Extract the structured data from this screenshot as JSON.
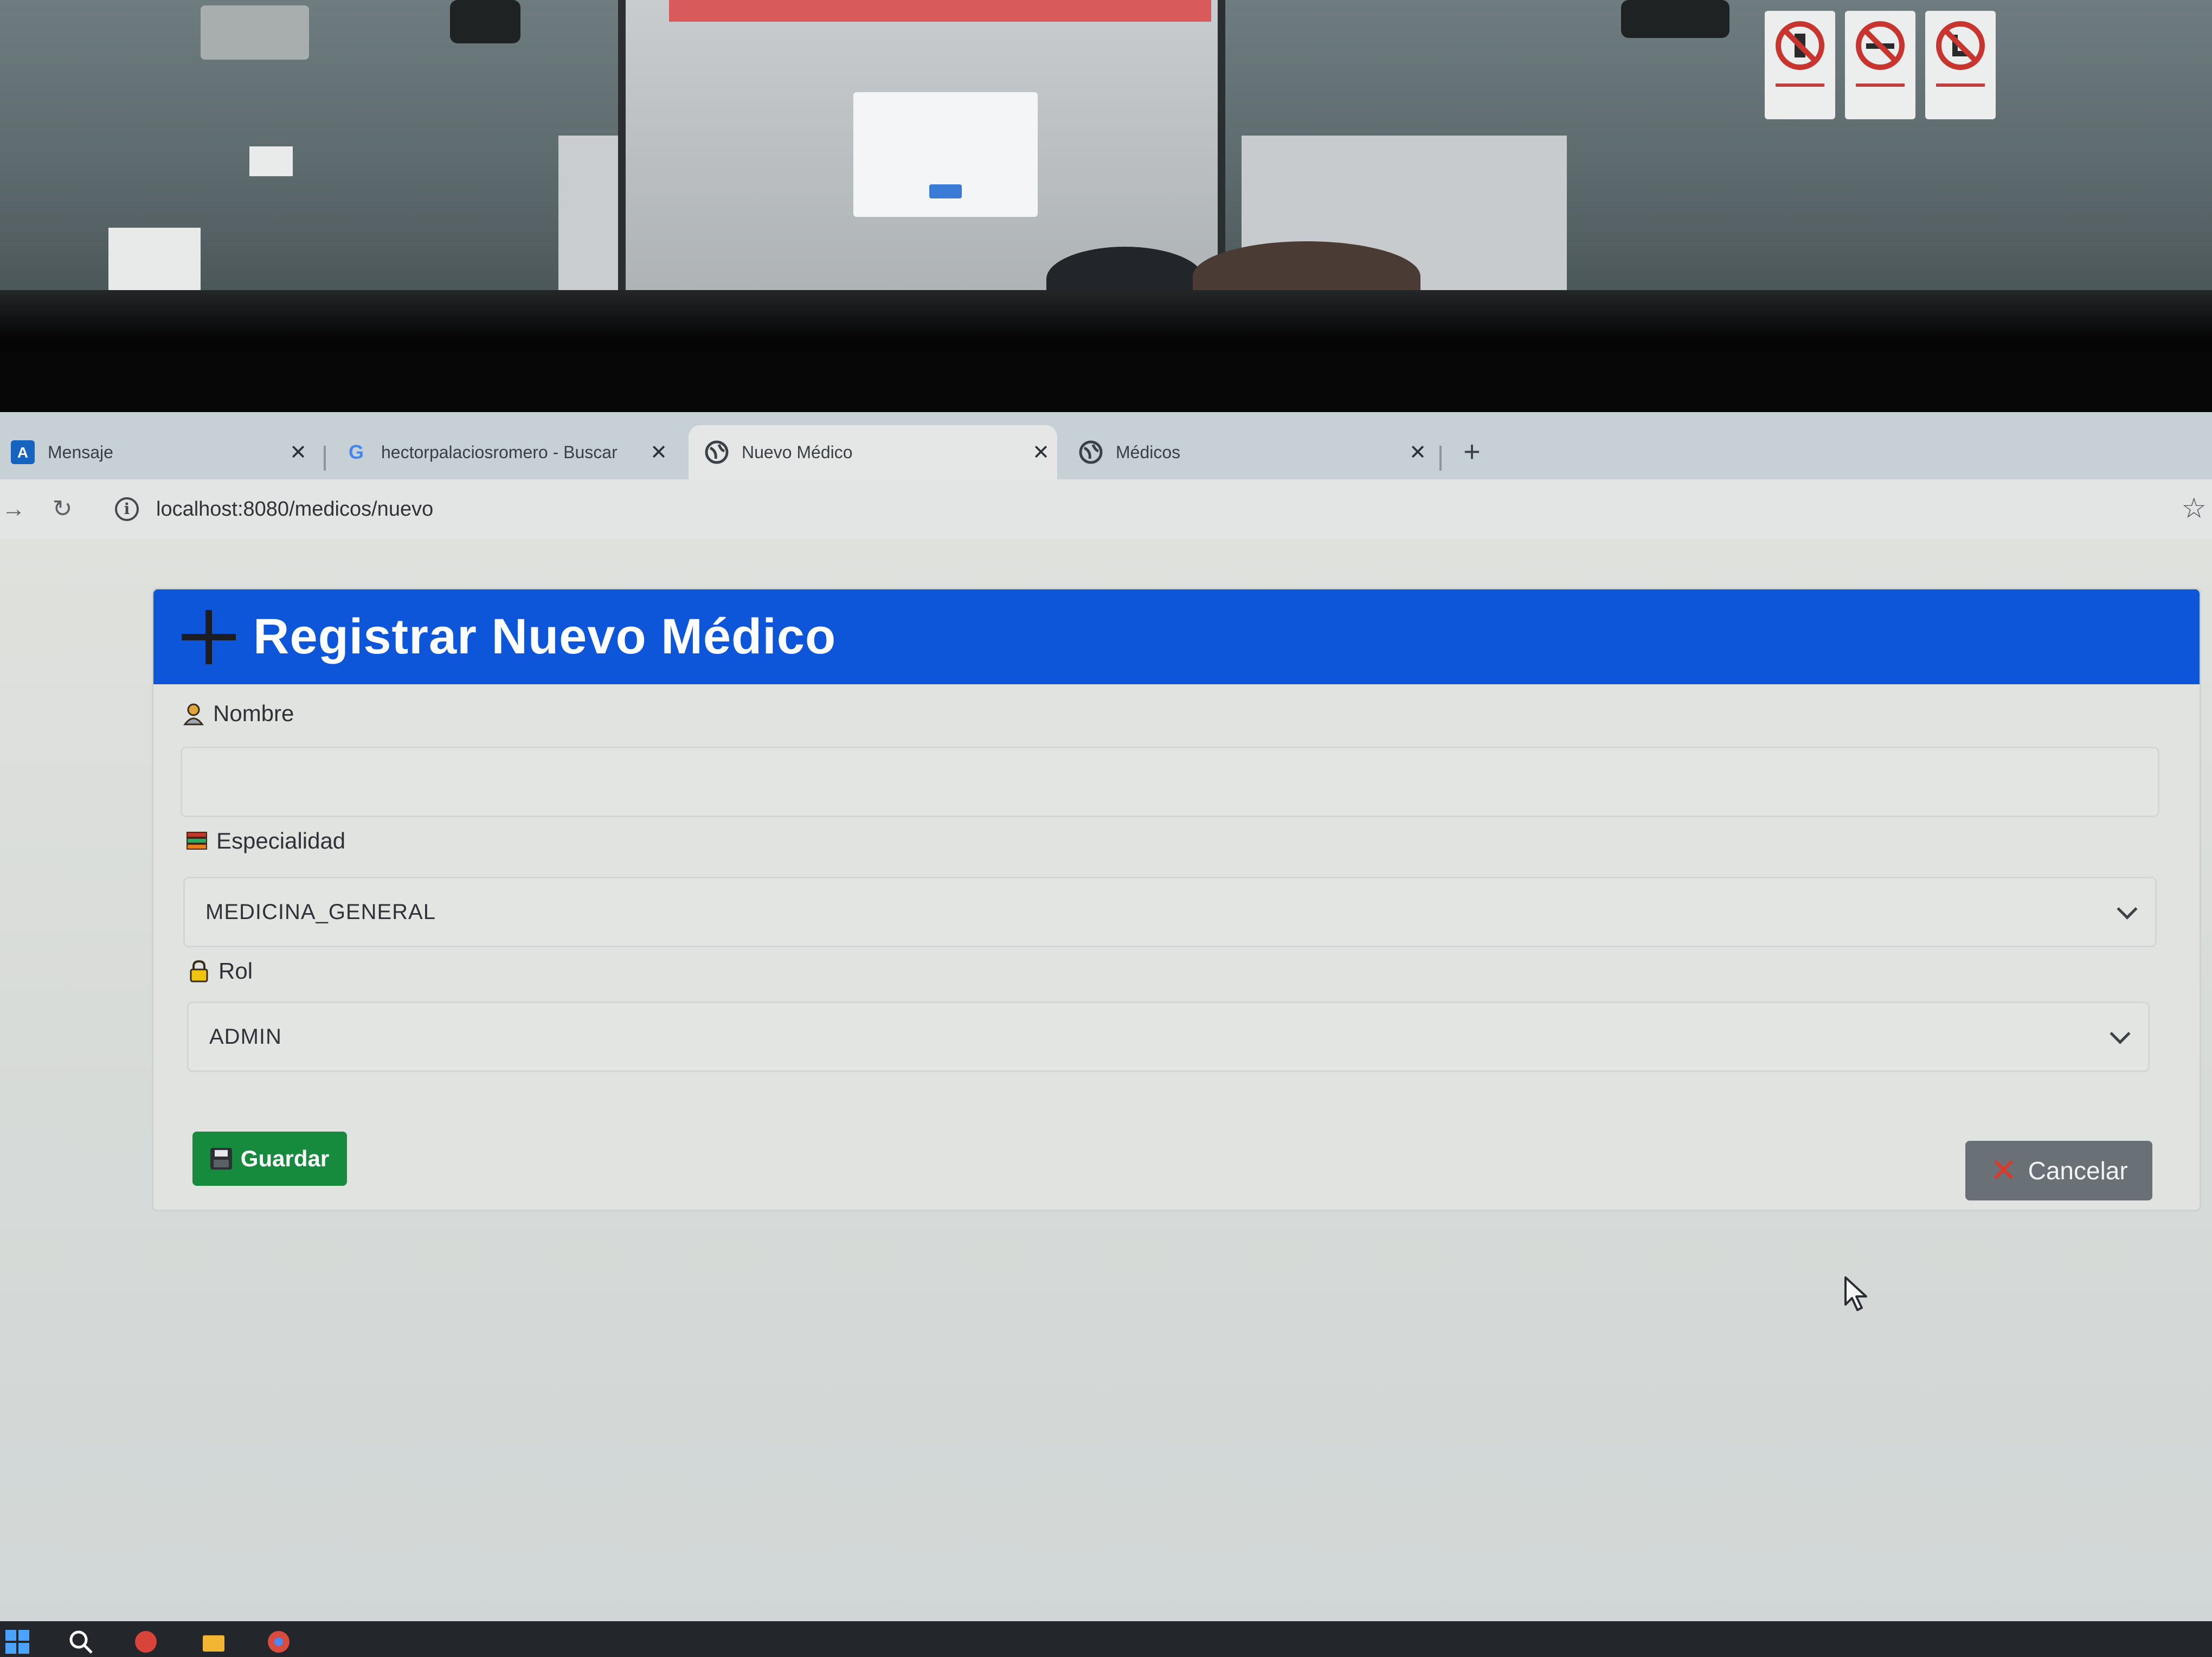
{
  "browser": {
    "tabs": [
      {
        "title": "Mensaje",
        "close": "✕",
        "icon": "outlook-icon",
        "active": false
      },
      {
        "title": "hectorpalaciosromero - Buscar",
        "close": "✕",
        "icon": "google-icon",
        "active": false
      },
      {
        "title": "Nuevo Médico",
        "close": "✕",
        "icon": "globe-icon",
        "active": true
      },
      {
        "title": "Médicos",
        "close": "✕",
        "icon": "globe-icon",
        "active": false
      }
    ],
    "new_tab": "+",
    "toolbar": {
      "forward": "→",
      "reload": "↻",
      "url": "localhost:8080/medicos/nuevo",
      "info": "i",
      "bookmark": "☆"
    }
  },
  "form": {
    "title": "Registrar Nuevo Médico",
    "fields": {
      "nombre": {
        "label": "Nombre",
        "value": ""
      },
      "especialidad": {
        "label": "Especialidad",
        "value": "MEDICINA_GENERAL"
      },
      "rol": {
        "label": "Rol",
        "value": "ADMIN"
      }
    },
    "save_label": "Guardar",
    "cancel_label": "Cancelar",
    "cancel_icon": "✕"
  },
  "colors": {
    "header_blue": "#0d56d9",
    "save_green": "#178b3d",
    "cancel_gray": "#697177",
    "cancel_x_red": "#d93a2a"
  }
}
